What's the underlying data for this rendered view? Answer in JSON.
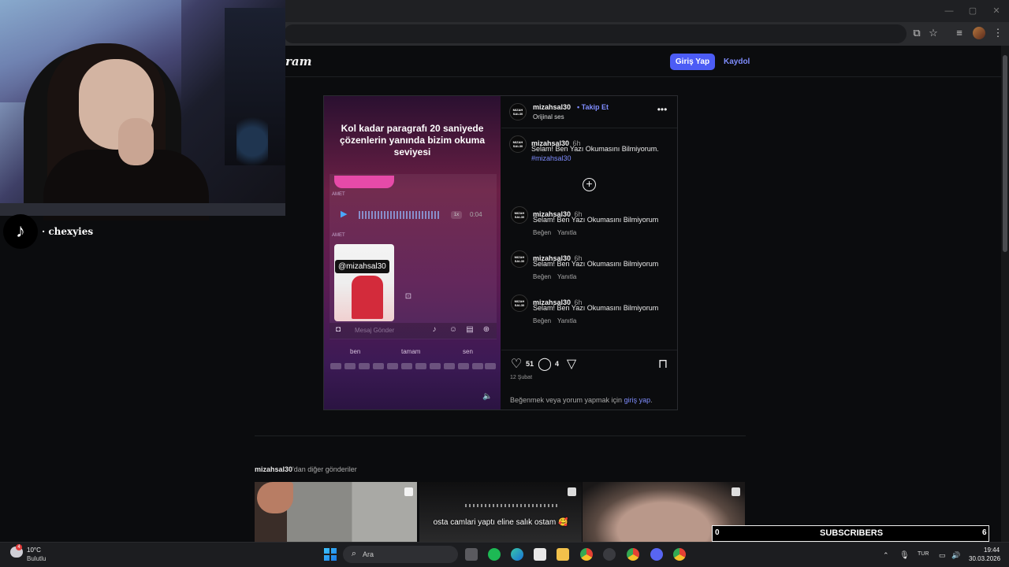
{
  "browser": {
    "window_controls": [
      "—",
      "▢",
      "✕"
    ]
  },
  "page": {
    "logo_text": "ram",
    "login_button": "Giriş Yap",
    "signup_link": "Kaydol"
  },
  "post": {
    "author": "mizahsal30",
    "follow_label": "• Takip Et",
    "audio": "Orijinal ses",
    "avatar_text": "MIZAH SAL30",
    "media": {
      "caption": "Kol kadar paragrafı 20 saniyede çözenlerin yanında bizim okuma seviyesi",
      "label_1": "AMET",
      "label_2": "AMET",
      "voice_speed": "1x",
      "voice_duration": "0:04",
      "tag": "@mizahsal30",
      "input_placeholder": "Mesaj Gönder",
      "keyboard_words": [
        "ben",
        "tamam",
        "sen"
      ]
    },
    "caption_comment": {
      "user": "mizahsal30",
      "time": "6h",
      "text": "Selam! Ben Yazı Okumasını Bilmiyorum.",
      "hashtag": "#mizahsal30"
    },
    "comments": [
      {
        "user": "mizahsal30",
        "time": "6h",
        "text": "Selam! Ben Yazı Okumasını Bilmiyorum",
        "like": "Beğen",
        "reply": "Yanıtla"
      },
      {
        "user": "mizahsal30",
        "time": "6h",
        "text": "Selam! Ben Yazı Okumasını Bilmiyorum",
        "like": "Beğen",
        "reply": "Yanıtla"
      },
      {
        "user": "mizahsal30",
        "time": "6h",
        "text": "Selam! Ben Yazı Okumasını Bilmiyorum",
        "like": "Beğen",
        "reply": "Yanıtla"
      }
    ],
    "likes": "51",
    "comment_count": "4",
    "date": "12 Şubat",
    "login_prompt": "Beğenmek veya yorum yapmak için ",
    "login_prompt_link": "giriş yap",
    "login_prompt_end": "."
  },
  "more_posts": {
    "user": "mizahsal30",
    "suffix": "'dan diğer gönderiler",
    "thumb2_caption": "osta camlari yaptı eline salık ostam 🥰"
  },
  "overlay": {
    "tiktok_handle": "· chexyies",
    "subscribers_label": "SUBSCRIBERS",
    "subscribers_left": "0",
    "subscribers_right": "6"
  },
  "taskbar": {
    "weather_temp": "10°C",
    "weather_desc": "Bulutlu",
    "weather_badge": "4",
    "search_placeholder": "Ara",
    "language": "TUR",
    "time": "19:44",
    "date": "30.03.2026"
  },
  "colors": {
    "accent": "#4c5cf5",
    "link": "#7f8dff",
    "background": "#0b0c0e"
  }
}
